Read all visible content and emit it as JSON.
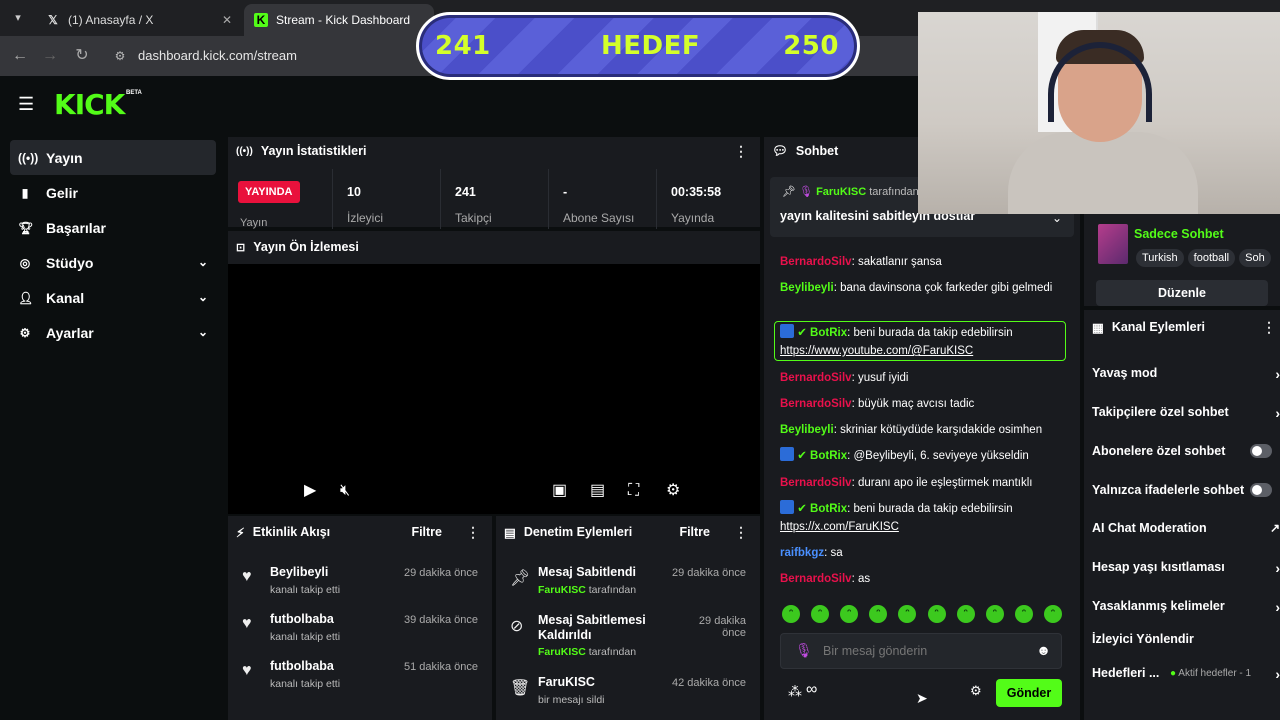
{
  "browser": {
    "tabs": [
      {
        "label": "(1) Anasayfa / X",
        "icon": "x-logo-icon"
      },
      {
        "label": "Stream - Kick Dashboard",
        "icon": "kick-logo-icon"
      }
    ],
    "url": "dashboard.kick.com/stream"
  },
  "goal_overlay": {
    "current": "241",
    "label": "HEDEF",
    "target": "250"
  },
  "header": {
    "logo": "KICK",
    "logo_badge": "BETA"
  },
  "sidebar": {
    "items": [
      {
        "label": "Yayın",
        "icon": "broadcast-icon",
        "active": true
      },
      {
        "label": "Gelir",
        "icon": "chart-icon"
      },
      {
        "label": "Başarılar",
        "icon": "trophy-icon"
      },
      {
        "label": "Stüdyo",
        "icon": "studio-icon",
        "expandable": true
      },
      {
        "label": "Kanal",
        "icon": "user-icon",
        "expandable": true
      },
      {
        "label": "Ayarlar",
        "icon": "gear-icon",
        "expandable": true
      }
    ]
  },
  "stats_panel": {
    "title": "Yayın İstatistikleri",
    "live_label": "YAYINDA",
    "live_sub": "Yayın",
    "stats": [
      {
        "value": "10",
        "label": "İzleyici"
      },
      {
        "value": "241",
        "label": "Takipçi"
      },
      {
        "value": "-",
        "label": "Abone Sayısı"
      },
      {
        "value": "00:35:58",
        "label": "Yayında"
      }
    ]
  },
  "preview_panel": {
    "title": "Yayın Ön İzlemesi"
  },
  "activity_panel": {
    "title": "Etkinlik Akışı",
    "filter_label": "Filtre",
    "items": [
      {
        "name": "Beylibeyli",
        "sub": "kanalı takip etti",
        "time": "29 dakika önce"
      },
      {
        "name": "futbolbaba",
        "sub": "kanalı takip etti",
        "time": "39 dakika önce"
      },
      {
        "name": "futbolbaba",
        "sub": "kanalı takip etti",
        "time": "51 dakika önce"
      }
    ]
  },
  "moderation_panel": {
    "title": "Denetim Eylemleri",
    "filter_label": "Filtre",
    "items": [
      {
        "name": "Mesaj Sabitlendi",
        "actor": "FaruKISC",
        "sub": "tarafından",
        "time": "29 dakika önce",
        "icon": "pin-icon"
      },
      {
        "name": "Mesaj Sabitlemesi Kaldırıldı",
        "actor": "FaruKISC",
        "sub": "tarafından",
        "time": "29 dakika önce",
        "icon": "unpin-icon"
      },
      {
        "name": "FaruKISC",
        "actor": "",
        "sub": "bir mesajı sildi",
        "time": "42 dakika önce",
        "icon": "trash-icon"
      }
    ]
  },
  "chat": {
    "title": "Sohbet",
    "pinned": {
      "user": "FaruKISC",
      "by": "tarafından",
      "text": "yayın kalitesini sabitleyin dostlar"
    },
    "messages": [
      {
        "user": "BernardoSilv",
        "color": "#e9114c",
        "text": ": sakatlanır şansa"
      },
      {
        "user": "Beylibeyli",
        "color": "#53fc18",
        "text": ": bana davinsona çok farkeder gibi gelmedi"
      },
      {
        "user": "BotRix",
        "color": "#53fc18",
        "text": ": beni burada da takip edebilirsin",
        "link": "https://www.youtube.com/@FaruKISC"
      },
      {
        "user": "BernardoSilv",
        "color": "#e9114c",
        "text": ": yusuf iyidi"
      },
      {
        "user": "BernardoSilv",
        "color": "#e9114c",
        "text": ": büyük maç avcısı tadic"
      },
      {
        "user": "Beylibeyli",
        "color": "#53fc18",
        "text": ": skriniar kötüydüde karşıdakide osimhen"
      },
      {
        "user": "BotRix",
        "color": "#53fc18",
        "text": ": @Beylibeyli, 6. seviyeye yükseldin"
      },
      {
        "user": "BernardoSilv",
        "color": "#e9114c",
        "text": ": duranı apo ile eşleştirmek mantıklı"
      },
      {
        "user": "BotRix",
        "color": "#53fc18",
        "text": ": beni burada da takip edebilirsin",
        "link": "https://x.com/FaruKISC"
      },
      {
        "user": "raifbkgz",
        "color": "#4a90ff",
        "text": ": sa"
      },
      {
        "user": "BernardoSilv",
        "color": "#e9114c",
        "text": ": as"
      }
    ],
    "input_placeholder": "Bir mesaj gönderin",
    "send_label": "Gönder"
  },
  "stream_info": {
    "category": "Sadece Sohbet",
    "tags": [
      "Turkish",
      "football",
      "Soh"
    ],
    "edit_label": "Düzenle"
  },
  "channel_actions": {
    "title": "Kanal Eylemleri",
    "items": [
      {
        "label": "Yavaş mod",
        "control": "arrow"
      },
      {
        "label": "Takipçilere özel sohbet",
        "control": "arrow"
      },
      {
        "label": "Abonelere özel sohbet",
        "control": "toggle"
      },
      {
        "label": "Yalnızca ifadelerle sohbet",
        "control": "toggle"
      },
      {
        "label": "AI Chat Moderation",
        "control": "external"
      },
      {
        "label": "Hesap yaşı kısıtlaması",
        "control": "arrow"
      },
      {
        "label": "Yasaklanmış kelimeler",
        "control": "arrow"
      },
      {
        "label": "İzleyici Yönlendir",
        "control": "none"
      },
      {
        "label": "Hedefleri ...",
        "control": "arrow",
        "status": "Aktif hedefler - 1"
      }
    ]
  },
  "colors": {
    "accent": "#53fc18",
    "live": "#e9113c",
    "panel": "#191b1f",
    "bg": "#0b0e0f"
  }
}
